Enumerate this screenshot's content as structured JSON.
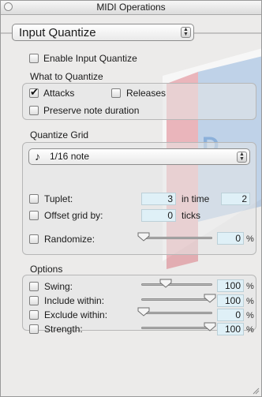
{
  "window": {
    "title": "MIDI Operations"
  },
  "operation_popup": {
    "selected": "Input Quantize"
  },
  "enable": {
    "label": "Enable Input Quantize",
    "checked": false
  },
  "what_to_quantize": {
    "heading": "What to Quantize",
    "attacks": {
      "label": "Attacks",
      "checked": true
    },
    "releases": {
      "label": "Releases",
      "checked": false
    },
    "preserve": {
      "label": "Preserve note duration",
      "checked": false
    }
  },
  "quantize_grid": {
    "heading": "Quantize Grid",
    "grid_popup": {
      "selected": "1/16 note",
      "icon": "sixteenth-note-icon"
    },
    "tuplet": {
      "label": "Tuplet:",
      "checked": false,
      "value": "3",
      "in_time_label": "in time",
      "in_time_value": "2"
    },
    "offset": {
      "label": "Offset grid by:",
      "checked": false,
      "value": "0",
      "unit": "ticks"
    },
    "randomize": {
      "label": "Randomize:",
      "checked": false,
      "value": "0",
      "unit": "%",
      "slider_fraction": 0.0
    }
  },
  "options": {
    "heading": "Options",
    "swing": {
      "label": "Swing:",
      "checked": false,
      "value": "100",
      "unit": "%",
      "slider_fraction": 0.33
    },
    "include": {
      "label": "Include within:",
      "checked": false,
      "value": "100",
      "unit": "%",
      "slider_fraction": 1.0
    },
    "exclude": {
      "label": "Exclude within:",
      "checked": false,
      "value": "0",
      "unit": "%",
      "slider_fraction": 0.0
    },
    "strength": {
      "label": "Strength:",
      "checked": false,
      "value": "100",
      "unit": "%",
      "slider_fraction": 1.0
    }
  },
  "colors": {
    "field_bg": "#dff0f7",
    "watermark_red": "#d23a4a",
    "watermark_blue": "#2d74c2"
  }
}
